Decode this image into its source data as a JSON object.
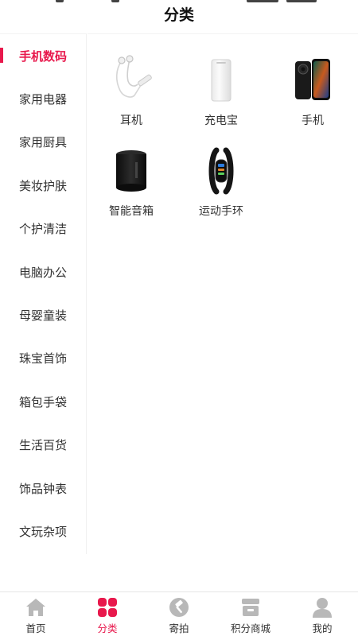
{
  "header": {
    "title": "分类"
  },
  "sidebar": {
    "items": [
      {
        "label": "手机数码",
        "active": true
      },
      {
        "label": "家用电器",
        "active": false
      },
      {
        "label": "家用厨具",
        "active": false
      },
      {
        "label": "美妆护肤",
        "active": false
      },
      {
        "label": "个护清洁",
        "active": false
      },
      {
        "label": "电脑办公",
        "active": false
      },
      {
        "label": "母婴童装",
        "active": false
      },
      {
        "label": "珠宝首饰",
        "active": false
      },
      {
        "label": "箱包手袋",
        "active": false
      },
      {
        "label": "生活百货",
        "active": false
      },
      {
        "label": "饰品钟表",
        "active": false
      },
      {
        "label": "文玩杂项",
        "active": false
      }
    ]
  },
  "products": [
    {
      "label": "耳机",
      "icon": "earphones-image"
    },
    {
      "label": "充电宝",
      "icon": "power-bank-image"
    },
    {
      "label": "手机",
      "icon": "smartphone-image"
    },
    {
      "label": "智能音箱",
      "icon": "smart-speaker-image"
    },
    {
      "label": "运动手环",
      "icon": "fitness-band-image"
    }
  ],
  "tabbar": {
    "items": [
      {
        "label": "首页",
        "icon": "home-icon",
        "active": false
      },
      {
        "label": "分类",
        "icon": "category-grid-icon",
        "active": true
      },
      {
        "label": "寄拍",
        "icon": "auction-hammer-icon",
        "active": false
      },
      {
        "label": "积分商城",
        "icon": "store-icon",
        "active": false
      },
      {
        "label": "我的",
        "icon": "user-icon",
        "active": false
      }
    ]
  },
  "colors": {
    "accent": "#e8184c",
    "text": "#333333",
    "icon_inactive": "#b8b8b8"
  }
}
